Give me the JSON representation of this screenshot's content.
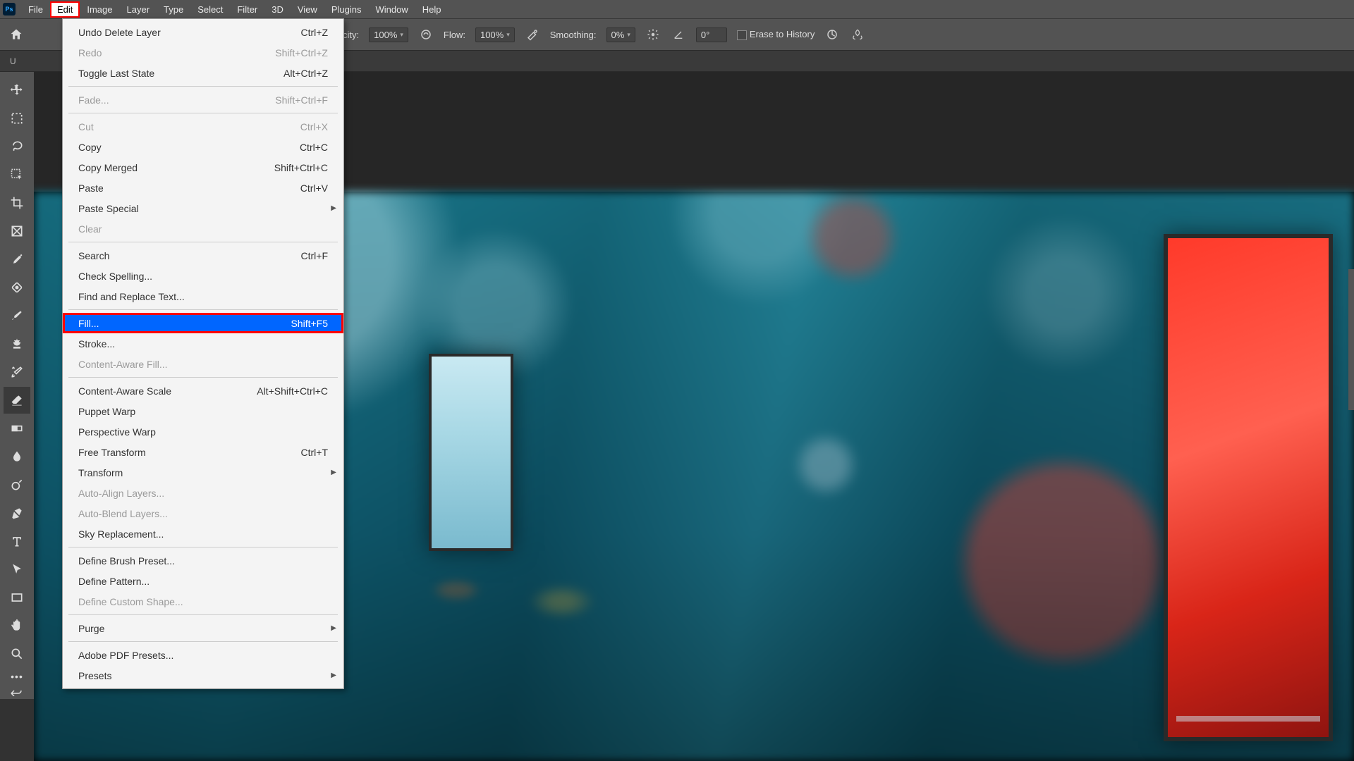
{
  "app": {
    "icon_label": "Ps"
  },
  "menubar": {
    "items": [
      "File",
      "Edit",
      "Image",
      "Layer",
      "Type",
      "Select",
      "Filter",
      "3D",
      "View",
      "Plugins",
      "Window",
      "Help"
    ],
    "active_index": 1
  },
  "optionsbar": {
    "opacity_label": "city:",
    "opacity_value": "100%",
    "flow_label": "Flow:",
    "flow_value": "100%",
    "smoothing_label": "Smoothing:",
    "smoothing_value": "0%",
    "angle_value": "0°",
    "erase_history_label": "Erase to History"
  },
  "tabbar": {
    "tab_label": "U"
  },
  "edit_menu": {
    "groups": [
      [
        {
          "label": "Undo Delete Layer",
          "shortcut": "Ctrl+Z",
          "disabled": false
        },
        {
          "label": "Redo",
          "shortcut": "Shift+Ctrl+Z",
          "disabled": true
        },
        {
          "label": "Toggle Last State",
          "shortcut": "Alt+Ctrl+Z",
          "disabled": false
        }
      ],
      [
        {
          "label": "Fade...",
          "shortcut": "Shift+Ctrl+F",
          "disabled": true
        }
      ],
      [
        {
          "label": "Cut",
          "shortcut": "Ctrl+X",
          "disabled": true
        },
        {
          "label": "Copy",
          "shortcut": "Ctrl+C",
          "disabled": false
        },
        {
          "label": "Copy Merged",
          "shortcut": "Shift+Ctrl+C",
          "disabled": false
        },
        {
          "label": "Paste",
          "shortcut": "Ctrl+V",
          "disabled": false
        },
        {
          "label": "Paste Special",
          "shortcut": "",
          "disabled": false,
          "submenu": true
        },
        {
          "label": "Clear",
          "shortcut": "",
          "disabled": true
        }
      ],
      [
        {
          "label": "Search",
          "shortcut": "Ctrl+F",
          "disabled": false
        },
        {
          "label": "Check Spelling...",
          "shortcut": "",
          "disabled": false
        },
        {
          "label": "Find and Replace Text...",
          "shortcut": "",
          "disabled": false
        }
      ],
      [
        {
          "label": "Fill...",
          "shortcut": "Shift+F5",
          "disabled": false,
          "highlighted": true
        },
        {
          "label": "Stroke...",
          "shortcut": "",
          "disabled": false
        },
        {
          "label": "Content-Aware Fill...",
          "shortcut": "",
          "disabled": true
        }
      ],
      [
        {
          "label": "Content-Aware Scale",
          "shortcut": "Alt+Shift+Ctrl+C",
          "disabled": false
        },
        {
          "label": "Puppet Warp",
          "shortcut": "",
          "disabled": false
        },
        {
          "label": "Perspective Warp",
          "shortcut": "",
          "disabled": false
        },
        {
          "label": "Free Transform",
          "shortcut": "Ctrl+T",
          "disabled": false
        },
        {
          "label": "Transform",
          "shortcut": "",
          "disabled": false,
          "submenu": true
        },
        {
          "label": "Auto-Align Layers...",
          "shortcut": "",
          "disabled": true
        },
        {
          "label": "Auto-Blend Layers...",
          "shortcut": "",
          "disabled": true
        },
        {
          "label": "Sky Replacement...",
          "shortcut": "",
          "disabled": false
        }
      ],
      [
        {
          "label": "Define Brush Preset...",
          "shortcut": "",
          "disabled": false
        },
        {
          "label": "Define Pattern...",
          "shortcut": "",
          "disabled": false
        },
        {
          "label": "Define Custom Shape...",
          "shortcut": "",
          "disabled": true
        }
      ],
      [
        {
          "label": "Purge",
          "shortcut": "",
          "disabled": false,
          "submenu": true
        }
      ],
      [
        {
          "label": "Adobe PDF Presets...",
          "shortcut": "",
          "disabled": false
        },
        {
          "label": "Presets",
          "shortcut": "",
          "disabled": false,
          "submenu": true
        }
      ]
    ]
  },
  "tools": [
    "move-tool",
    "marquee-tool",
    "lasso-tool",
    "object-select-tool",
    "crop-tool",
    "frame-tool",
    "eyedropper-tool",
    "spot-heal-tool",
    "brush-tool",
    "clone-stamp-tool",
    "history-brush-tool",
    "eraser-tool",
    "gradient-tool",
    "blur-tool",
    "dodge-tool",
    "pen-tool",
    "type-tool",
    "path-select-tool",
    "rectangle-tool",
    "hand-tool",
    "zoom-tool"
  ],
  "highlight": {
    "menu_outline_color": "#ff0000",
    "highlight_bg": "#0066ff"
  }
}
